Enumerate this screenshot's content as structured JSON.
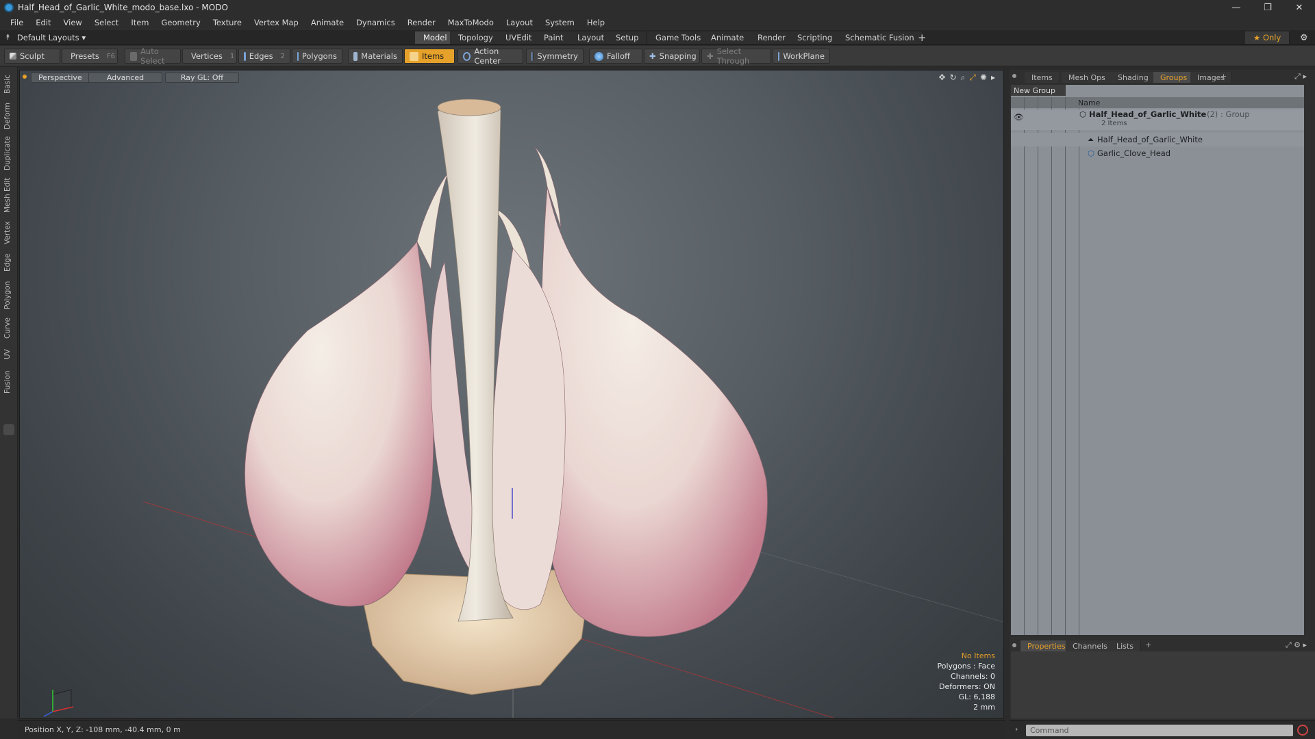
{
  "window": {
    "title": "Half_Head_of_Garlic_White_modo_base.lxo - MODO",
    "min": "—",
    "restore": "❐",
    "close": "✕"
  },
  "menu": [
    "File",
    "Edit",
    "View",
    "Select",
    "Item",
    "Geometry",
    "Texture",
    "Vertex Map",
    "Animate",
    "Dynamics",
    "Render",
    "MaxToModo",
    "Layout",
    "System",
    "Help"
  ],
  "layouts": {
    "dropdown": "Default Layouts ▾",
    "tabs": [
      "Model",
      "Topology",
      "UVEdit",
      "Paint",
      "Layout",
      "Setup",
      "Game Tools",
      "Animate",
      "Render",
      "Scripting",
      "Schematic Fusion"
    ],
    "active_tab": "Model",
    "add": "+",
    "only": "★  Only",
    "gear": "⚙"
  },
  "toolbar": {
    "sculpt": "Sculpt",
    "presets": "Presets",
    "presets_key": "F6",
    "auto_select": "Auto Select",
    "vertices": "Vertices",
    "vertices_key": "1",
    "edges": "Edges",
    "edges_key": "2",
    "polygons": "Polygons",
    "materials": "Materials",
    "items": "Items",
    "action_center": "Action Center",
    "symmetry": "Symmetry",
    "falloff": "Falloff",
    "snapping": "Snapping",
    "select_through": "Select Through",
    "workplane": "WorkPlane"
  },
  "left_tabs": [
    "Basic",
    "Deform",
    "Duplicate",
    "Mesh Edit",
    "Vertex",
    "Edge",
    "Polygon",
    "Curve",
    "UV",
    "Fusion"
  ],
  "viewport": {
    "perspective": "Perspective",
    "advanced": "Advanced",
    "raygl": "Ray GL: Off",
    "stats": {
      "selection": "No Items",
      "polygons": "Polygons : Face",
      "channels": "Channels: 0",
      "deformers": "Deformers: ON",
      "gl": "GL: 6,188",
      "scale": "2 mm"
    }
  },
  "status": {
    "position": "Position X, Y, Z:  -108 mm, -40.4 mm, 0 m"
  },
  "right_tabs": [
    "Items",
    "Mesh Ops",
    "Shading",
    "Groups",
    "Images"
  ],
  "right_active": "Groups",
  "groups": {
    "new_group": "New Group",
    "column_name": "Name",
    "root": {
      "name": "Half_Head_of_Garlic_White",
      "count": "(2)",
      "type": ": Group",
      "sub": "2 Items"
    },
    "children": [
      "Half_Head_of_Garlic_White",
      "Garlic_Clove_Head"
    ]
  },
  "bottom_tabs": [
    "Properties",
    "Channels",
    "Lists"
  ],
  "bottom_active": "Properties",
  "command": {
    "placeholder": "Command"
  },
  "colors": {
    "accent": "#e6a12a",
    "panel": "#8a9096",
    "viewport": "#565d63"
  }
}
